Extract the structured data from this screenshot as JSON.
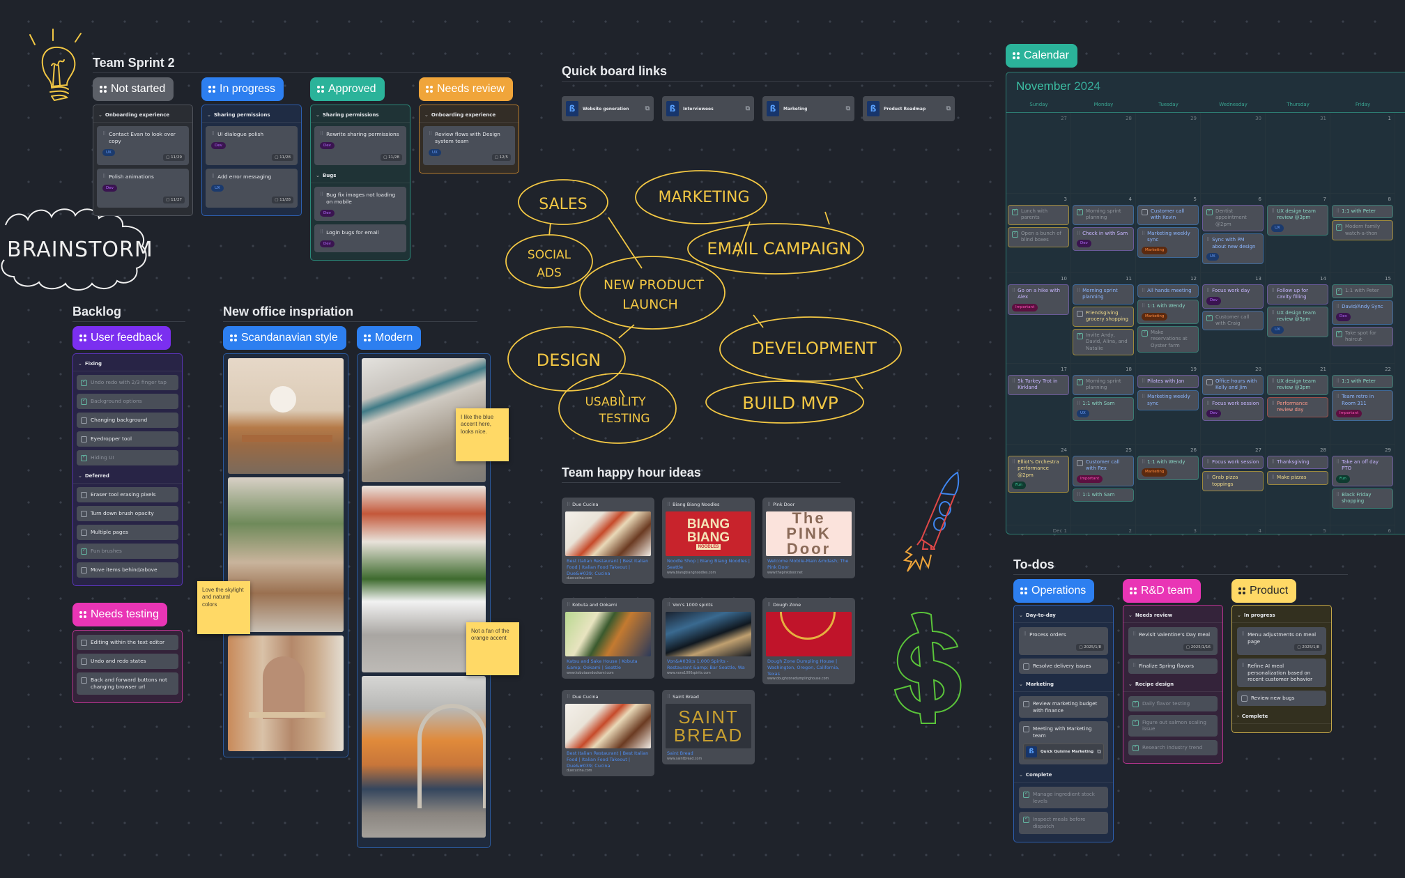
{
  "sprint": {
    "title": "Team Sprint 2",
    "columns": [
      {
        "label": "Not started",
        "color": "#5c6068",
        "groups": [
          {
            "name": "Onboarding experience",
            "cards": [
              {
                "title": "Contact Evan to look over copy",
                "tag": "UX",
                "date": "11/29"
              },
              {
                "title": "Polish animations",
                "tag": "Dev",
                "date": "11/27"
              }
            ]
          }
        ]
      },
      {
        "label": "In progress",
        "color": "#2d7ff0",
        "groups": [
          {
            "name": "Sharing permissions",
            "cards": [
              {
                "title": "UI dialogue polish",
                "tag": "Dev",
                "date": "11/28"
              },
              {
                "title": "Add error messaging",
                "tag": "UX",
                "date": "11/28"
              }
            ]
          }
        ]
      },
      {
        "label": "Approved",
        "color": "#2bb39a",
        "groups": [
          {
            "name": "Sharing permissions",
            "cards": [
              {
                "title": "Rewrite sharing permissions",
                "tag": "Dev",
                "date": "11/28"
              }
            ]
          },
          {
            "name": "Bugs",
            "cards": [
              {
                "title": "Bug fix images not loading on mobile",
                "tag": "Dev"
              },
              {
                "title": "Login bugs for email",
                "tag": "Dev"
              }
            ]
          }
        ]
      },
      {
        "label": "Needs review",
        "color": "#f0a53a",
        "groups": [
          {
            "name": "Onboarding experience",
            "cards": [
              {
                "title": "Review flows with Design system team",
                "tag": "UX",
                "date": "12/5"
              }
            ]
          }
        ]
      }
    ]
  },
  "drawings": {
    "brainstorm": "BRAINSTORM",
    "mindmap": {
      "center": [
        "NEW PRODUCT",
        "LAUNCH"
      ],
      "nodes": [
        "SALES",
        "SOCIAL",
        "ADS",
        "MARKETING",
        "EMAIL CAMPAIGN",
        "DESIGN",
        "USABILITY",
        "TESTING",
        "DEVELOPMENT",
        "BUILD MVP"
      ]
    }
  },
  "backlog": {
    "title": "Backlog",
    "user_feedback": {
      "label": "User feedback",
      "color": "#7b2ff0",
      "groups": [
        {
          "name": "Fixing",
          "items": [
            {
              "text": "Undo redo with 2/3 finger tap",
              "done": true
            },
            {
              "text": "Background options",
              "done": true
            },
            {
              "text": "Changing background",
              "done": false
            },
            {
              "text": "Eyedropper tool",
              "done": false
            },
            {
              "text": "Hiding UI",
              "done": true
            }
          ]
        },
        {
          "name": "Deferred",
          "items": [
            {
              "text": "Eraser tool erasing pixels",
              "done": false
            },
            {
              "text": "Turn down brush opacity",
              "done": false
            },
            {
              "text": "Multiple pages",
              "done": false
            },
            {
              "text": "Fun brushes",
              "done": true
            },
            {
              "text": "Move items behind/above",
              "done": false
            }
          ]
        }
      ]
    },
    "needs_testing": {
      "label": "Needs testing",
      "color": "#e935b5",
      "items": [
        {
          "text": "Editing within the text editor",
          "done": false
        },
        {
          "text": "Undo and redo states",
          "done": false
        },
        {
          "text": "Back and forward buttons not changing browser url",
          "done": false
        }
      ]
    }
  },
  "office": {
    "title": "New office inspriation",
    "scandi_label": "Scandanavian style",
    "modern_label": "Modern",
    "notes": {
      "skylight": "Love the skylight and natural colors",
      "blue": "I like the blue accent here, looks nice.",
      "orange": "Not a fan of the orange accent"
    }
  },
  "quick_links": {
    "title": "Quick board links",
    "items": [
      "Website generation",
      "Interviewees",
      "Marketing",
      "Product Roadmap"
    ]
  },
  "happy_hour": {
    "title": "Team happy hour ideas",
    "cards": [
      {
        "name": "Due Cucina",
        "link": "Best Italian Restaurant | Best Italian Food | Italian Food Takeout | Due&#039; Cucina",
        "domain": "duecucina.com"
      },
      {
        "name": "Biang Biang Noodles",
        "link": "Noodle Shop | Biang Biang Noodles | Seattle",
        "domain": "www.biangbiangnoodles.com",
        "img_text": [
          "BIANG",
          "BIANG",
          "NOODLES"
        ]
      },
      {
        "name": "Pink Door",
        "link": "Welcome Mobile-Main &mdash; The Pink Door",
        "domain": "www.thepinkdoor.net",
        "img_text": [
          "The",
          "PINK",
          "Door"
        ]
      },
      {
        "name": "Kobuta and Ookami",
        "link": "Katsu and Sake House | Kobuta &amp; Ookami | Seattle",
        "domain": "www.kobutaandookami.com"
      },
      {
        "name": "Von's 1000 spirits",
        "link": "Von&#039;s 1,000 Spirits - Restaurant &amp; Bar Seattle, Wa",
        "domain": "www.vons1000spirits.com"
      },
      {
        "name": "Dough Zone",
        "link": "Dough Zone Dumpling House | Washington, Oregon, California, Texas",
        "domain": "www.doughzonedumplinghouse.com"
      },
      {
        "name": "Due Cucina",
        "link": "Best Italian Restaurant | Best Italian Food | Italian Food Takeout | Due&#039; Cucina",
        "domain": "duecucina.com"
      },
      {
        "name": "Saint Bread",
        "link": "Saint Bread",
        "domain": "www.saintbread.com",
        "img_text": [
          "SAINT",
          "BREAD"
        ]
      }
    ]
  },
  "calendar": {
    "label": "Calendar",
    "month": "November",
    "year": "2024",
    "weekdays": [
      "Sunday",
      "Monday",
      "Tuesday",
      "Wednesday",
      "Thursday",
      "Friday"
    ],
    "weeks": [
      [
        {
          "day": "27",
          "events": []
        },
        {
          "day": "28",
          "events": []
        },
        {
          "day": "29",
          "events": []
        },
        {
          "day": "30",
          "events": []
        },
        {
          "day": "31",
          "events": []
        },
        {
          "day": "1",
          "events": []
        }
      ],
      [
        {
          "day": "3",
          "events": [
            {
              "text": "Lunch with parents",
              "kind": "check",
              "done": true,
              "color": "yellow"
            },
            {
              "text": "Open a bunch of blind boxes",
              "kind": "check",
              "done": true,
              "color": "yellow"
            }
          ]
        },
        {
          "day": "4",
          "events": [
            {
              "text": "Morning sprint planning",
              "kind": "check",
              "done": true,
              "color": "blue"
            },
            {
              "text": "Check in with Sam",
              "kind": "drag",
              "color": "purple",
              "tag": "Dev"
            }
          ]
        },
        {
          "day": "5",
          "events": [
            {
              "text": "Customer call with Kevin",
              "kind": "check",
              "done": false,
              "color": "blue"
            },
            {
              "text": "Marketing weekly sync",
              "kind": "drag",
              "color": "blue",
              "tag": "Marketing"
            }
          ]
        },
        {
          "day": "6",
          "events": [
            {
              "text": "Dentist appointment @2pm",
              "kind": "check",
              "done": true,
              "color": "purple"
            },
            {
              "text": "Sync with PM about new design",
              "kind": "drag",
              "color": "blue",
              "tag": "UX"
            }
          ]
        },
        {
          "day": "7",
          "events": [
            {
              "text": "UX design team review @3pm",
              "kind": "drag",
              "color": "teal",
              "tag": "UX"
            }
          ]
        },
        {
          "day": "8",
          "events": [
            {
              "text": "1:1 with Peter",
              "kind": "drag",
              "color": "teal"
            },
            {
              "text": "Modern family watch-a-thon",
              "kind": "check",
              "done": true,
              "color": "yellow"
            }
          ]
        }
      ],
      [
        {
          "day": "10",
          "events": [
            {
              "text": "Go on a hike with Alex",
              "kind": "drag",
              "color": "purple",
              "tag": "Important"
            }
          ]
        },
        {
          "day": "11",
          "events": [
            {
              "text": "Morning sprint planning",
              "kind": "drag",
              "color": "blue"
            },
            {
              "text": "Friendsgiving grocery shopping",
              "kind": "check",
              "done": false,
              "color": "yellow"
            },
            {
              "text": "Invite Andy, David, Alina, and Natalie",
              "kind": "check",
              "done": true,
              "color": "yellow"
            }
          ]
        },
        {
          "day": "12",
          "events": [
            {
              "text": "All hands meeting",
              "kind": "drag",
              "color": "blue"
            },
            {
              "text": "1:1 with Wendy",
              "kind": "drag",
              "color": "teal",
              "tag": "Marketing"
            },
            {
              "text": "Make reservations at Oyster farm",
              "kind": "check",
              "done": true,
              "color": "teal"
            }
          ]
        },
        {
          "day": "13",
          "events": [
            {
              "text": "Focus work day",
              "kind": "drag",
              "color": "purple",
              "tag": "Dev"
            },
            {
              "text": "Customer call with Craig",
              "kind": "check",
              "done": true,
              "color": "blue"
            }
          ]
        },
        {
          "day": "14",
          "events": [
            {
              "text": "Follow up for cavity filling",
              "kind": "drag",
              "color": "purple"
            },
            {
              "text": "UX design team review @3pm",
              "kind": "drag",
              "color": "teal",
              "tag": "UX"
            }
          ]
        },
        {
          "day": "15",
          "events": [
            {
              "text": "1:1 with Peter",
              "kind": "check",
              "done": true,
              "color": "teal"
            },
            {
              "text": "David/Andy Sync",
              "kind": "drag",
              "color": "blue",
              "tag": "Dev"
            },
            {
              "text": "Take spot for haircut",
              "kind": "check",
              "done": true,
              "color": "purple"
            }
          ]
        }
      ],
      [
        {
          "day": "17",
          "events": [
            {
              "text": "5k Turkey Trot in Kirkland",
              "kind": "drag",
              "color": "purple"
            }
          ]
        },
        {
          "day": "18",
          "events": [
            {
              "text": "Morning sprint planning",
              "kind": "check",
              "done": true,
              "color": "blue"
            },
            {
              "text": "1:1 with Sam",
              "kind": "drag",
              "color": "teal",
              "tag": "UX"
            }
          ]
        },
        {
          "day": "19",
          "events": [
            {
              "text": "Pilates with Jan",
              "kind": "drag",
              "color": "purple"
            },
            {
              "text": "Marketing weekly sync",
              "kind": "drag",
              "color": "blue"
            }
          ]
        },
        {
          "day": "20",
          "events": [
            {
              "text": "Office hours with Kelly and Jim",
              "kind": "check",
              "done": false,
              "color": "blue"
            },
            {
              "text": "Focus work session",
              "kind": "drag",
              "color": "purple",
              "tag": "Dev"
            }
          ]
        },
        {
          "day": "21",
          "events": [
            {
              "text": "UX design team review @3pm",
              "kind": "drag",
              "color": "teal"
            },
            {
              "text": "Performance review day",
              "kind": "drag",
              "color": "red"
            }
          ]
        },
        {
          "day": "22",
          "events": [
            {
              "text": "1:1 with Peter",
              "kind": "drag",
              "color": "teal"
            },
            {
              "text": "Team retro in Room 311",
              "kind": "drag",
              "color": "blue",
              "tag": "Important"
            }
          ]
        }
      ],
      [
        {
          "day": "24",
          "events": [
            {
              "text": "Elliot's Orchestra performance @2pm",
              "kind": "drag",
              "color": "yellow",
              "tag": "Fun"
            }
          ]
        },
        {
          "day": "25",
          "events": [
            {
              "text": "Customer call with Rex",
              "kind": "check",
              "done": false,
              "color": "blue",
              "tag": "Important"
            },
            {
              "text": "1:1 with Sam",
              "kind": "drag",
              "color": "teal"
            }
          ]
        },
        {
          "day": "26",
          "events": [
            {
              "text": "1:1 with Wendy",
              "kind": "drag",
              "color": "teal",
              "tag": "Marketing"
            }
          ]
        },
        {
          "day": "27",
          "events": [
            {
              "text": "Focus work session",
              "kind": "drag",
              "color": "purple"
            },
            {
              "text": "Grab pizza toppings",
              "kind": "drag",
              "color": "yellow"
            }
          ]
        },
        {
          "day": "28",
          "events": [
            {
              "text": "Thanksgiving",
              "kind": "drag",
              "color": "purple"
            },
            {
              "text": "Make pizzas",
              "kind": "drag",
              "color": "yellow"
            }
          ]
        },
        {
          "day": "29",
          "events": [
            {
              "text": "Take an off day PTO",
              "kind": "drag",
              "color": "purple",
              "tag": "Fun"
            },
            {
              "text": "Black Friday shopping",
              "kind": "drag",
              "color": "teal"
            }
          ]
        }
      ],
      [
        {
          "day": "Dec 1",
          "events": []
        },
        {
          "day": "2",
          "events": []
        },
        {
          "day": "3",
          "events": []
        },
        {
          "day": "4",
          "events": []
        },
        {
          "day": "5",
          "events": []
        },
        {
          "day": "6",
          "events": []
        }
      ]
    ]
  },
  "todos": {
    "title": "To-dos",
    "columns": [
      {
        "label": "Operations",
        "color": "#2d7ff0",
        "groups": [
          {
            "name": "Day-to-day",
            "items": [
              {
                "text": "Process orders",
                "kind": "drag",
                "date": "2025/1/8"
              },
              {
                "text": "Resolve delivery issues",
                "kind": "check",
                "done": false
              }
            ]
          },
          {
            "name": "Marketing",
            "items": [
              {
                "text": "Review marketing budget with finance",
                "kind": "check",
                "done": false
              },
              {
                "text": "Meeting with Marketing team",
                "kind": "check",
                "done": false,
                "link": "Quick Quisine Marketing"
              }
            ]
          },
          {
            "name": "Complete",
            "items": [
              {
                "text": "Manage ingredient stock levels",
                "kind": "check",
                "done": true
              },
              {
                "text": "Inspect meals before dispatch",
                "kind": "check",
                "done": true
              }
            ]
          }
        ]
      },
      {
        "label": "R&D team",
        "color": "#e935b5",
        "groups": [
          {
            "name": "Needs review",
            "items": [
              {
                "text": "Revisit Valentine's Day meal",
                "kind": "drag",
                "date": "2025/1/16"
              },
              {
                "text": "Finalize Spring flavors",
                "kind": "drag"
              }
            ]
          },
          {
            "name": "Recipe design",
            "items": [
              {
                "text": "Daily flavor testing",
                "kind": "check",
                "done": true
              },
              {
                "text": "Figure out salmon scaling issue",
                "kind": "check",
                "done": true
              },
              {
                "text": "Research industry trend",
                "kind": "check",
                "done": true
              }
            ]
          }
        ]
      },
      {
        "label": "Product",
        "color": "#ffd966",
        "groups": [
          {
            "name": "In progress",
            "items": [
              {
                "text": "Menu adjustments on meal page",
                "kind": "drag",
                "date": "2025/1/8"
              },
              {
                "text": "Refine AI meal personalization based on recent customer behavior",
                "kind": "drag"
              },
              {
                "text": "Review new bugs",
                "kind": "check",
                "done": false
              }
            ]
          },
          {
            "name": "Complete",
            "collapsed": true,
            "items": []
          }
        ]
      }
    ]
  }
}
